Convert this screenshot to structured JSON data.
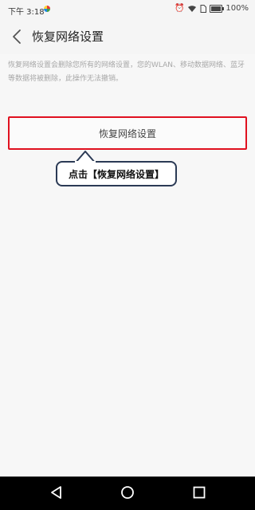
{
  "status_bar": {
    "time": "下午 3:18",
    "battery": "100%",
    "icons": [
      "notification-icon",
      "alarm-icon",
      "wifi-icon",
      "sim-icon",
      "battery-icon"
    ]
  },
  "header": {
    "title": "恢复网络设置",
    "back_icon": "back-arrow-icon"
  },
  "main": {
    "description": "恢复网络设置会删除您所有的网络设置，您的WLAN、移动数据网络、蓝牙等数据将被删除，此操作无法撤销。",
    "reset_button_label": "恢复网络设置",
    "highlight_color": "#e0101f"
  },
  "callout": {
    "text": "点击【恢复网络设置】"
  },
  "nav_bar": {
    "icons": [
      "back-icon",
      "home-icon",
      "recents-icon"
    ]
  }
}
